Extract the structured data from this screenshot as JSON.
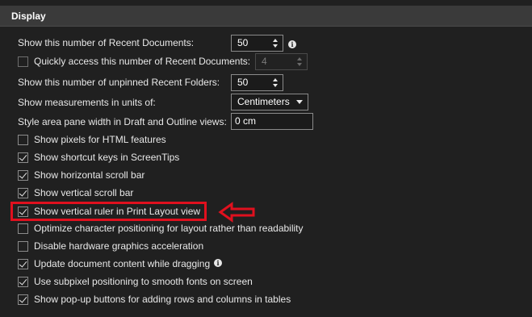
{
  "section": {
    "title": "Display"
  },
  "recent_docs": {
    "label": "Show this number of Recent Documents:",
    "value": "50"
  },
  "quick_access": {
    "label": "Quickly access this number of Recent Documents:",
    "value": "4",
    "checked": false,
    "enabled": false
  },
  "recent_folders": {
    "label": "Show this number of unpinned Recent Folders:",
    "value": "50"
  },
  "units": {
    "label": "Show measurements in units of:",
    "selected": "Centimeters"
  },
  "style_area": {
    "label": "Style area pane width in Draft and Outline views:",
    "value": "0 cm"
  },
  "checkboxes": [
    {
      "label": "Show pixels for HTML features",
      "checked": false
    },
    {
      "label": "Show shortcut keys in ScreenTips",
      "checked": true
    },
    {
      "label": "Show horizontal scroll bar",
      "checked": true
    },
    {
      "label": "Show vertical scroll bar",
      "checked": true
    },
    {
      "label": "Show vertical ruler in Print Layout view",
      "checked": true
    },
    {
      "label": "Optimize character positioning for layout rather than readability",
      "checked": false
    },
    {
      "label": "Disable hardware graphics acceleration",
      "checked": false
    },
    {
      "label": "Update document content while dragging",
      "checked": true
    },
    {
      "label": "Use subpixel positioning to smooth fonts on screen",
      "checked": true
    },
    {
      "label": "Show pop-up buttons for adding rows and columns in tables",
      "checked": true
    }
  ],
  "icons": {
    "info": "info-icon",
    "info_glyph": "i",
    "annotation_arrow": "arrow-left-icon"
  },
  "colors": {
    "annotation": "#e0101e",
    "background": "#202020",
    "header": "#3a3a3a"
  }
}
